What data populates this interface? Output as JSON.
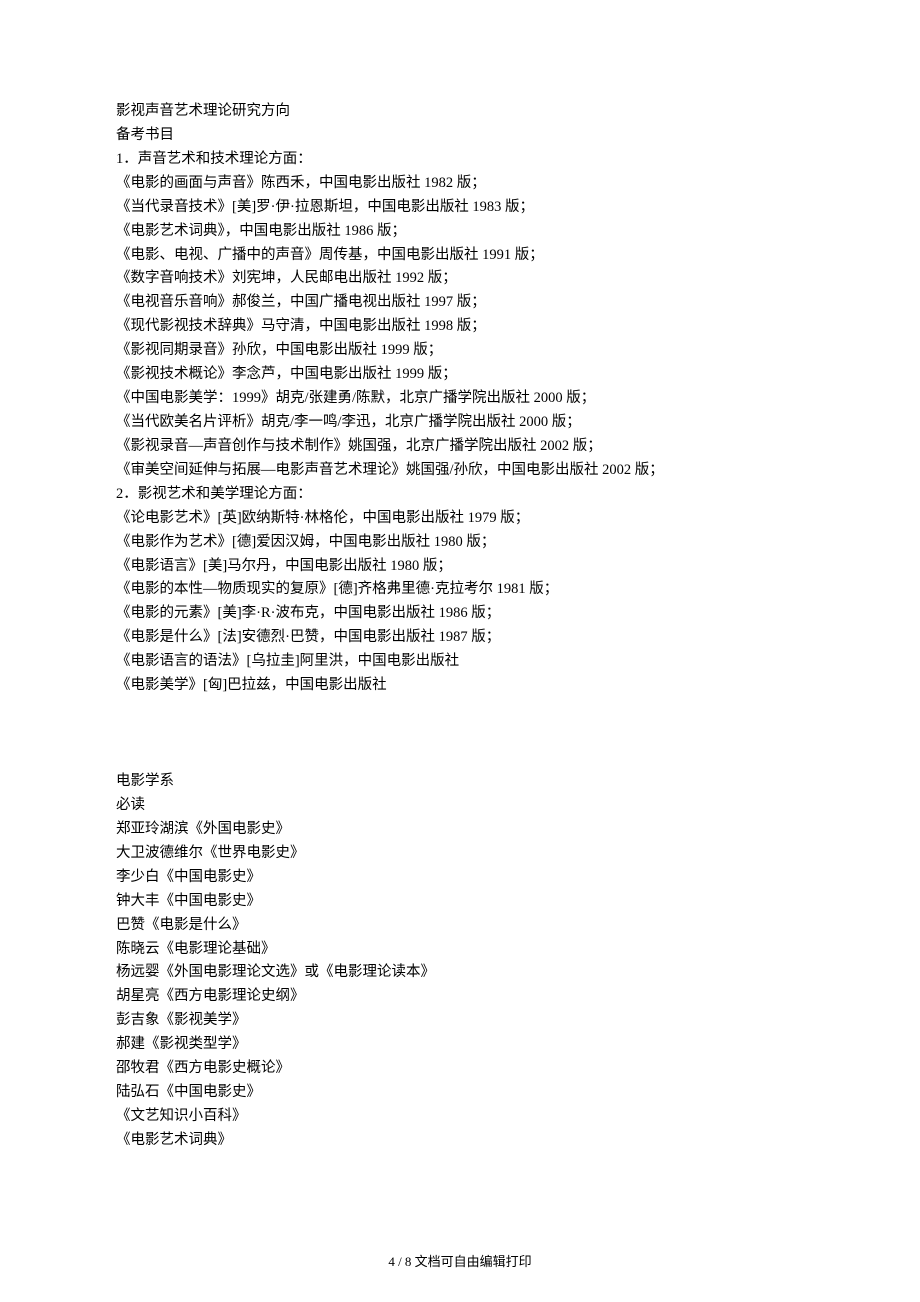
{
  "section1": {
    "title": "影视声音艺术理论研究方向",
    "subtitle": "备考书目",
    "cat1_header": "1．声音艺术和技术理论方面：",
    "cat1_items": [
      "《电影的画面与声音》陈西禾，中国电影出版社 1982 版；",
      "《当代录音技术》[美]罗·伊·拉恩斯坦，中国电影出版社 1983 版；",
      "《电影艺术词典》，中国电影出版社 1986 版；",
      "《电影、电视、广播中的声音》周传基，中国电影出版社 1991 版；",
      "《数字音响技术》刘宪坤，人民邮电出版社 1992 版；",
      "《电视音乐音响》郝俊兰，中国广播电视出版社 1997 版；",
      "《现代影视技术辞典》马守清，中国电影出版社 1998 版；",
      "《影视同期录音》孙欣，中国电影出版社 1999 版；",
      "《影视技术概论》李念芦，中国电影出版社 1999 版；",
      "《中国电影美学：1999》胡克/张建勇/陈默，北京广播学院出版社 2000 版；",
      "《当代欧美名片评析》胡克/李一鸣/李迅，北京广播学院出版社 2000 版；",
      "《影视录音—声音创作与技术制作》姚国强，北京广播学院出版社 2002 版；",
      "《审美空间延伸与拓展—电影声音艺术理论》姚国强/孙欣，中国电影出版社 2002 版；"
    ],
    "cat2_header": "2．影视艺术和美学理论方面：",
    "cat2_items": [
      "《论电影艺术》[英]欧纳斯特·林格伦，中国电影出版社 1979 版；",
      "《电影作为艺术》[德]爱因汉姆，中国电影出版社 1980 版；",
      "《电影语言》[美]马尔丹，中国电影出版社 1980 版；",
      "《电影的本性—物质现实的复原》[德]齐格弗里德·克拉考尔 1981 版；",
      "《电影的元素》[美]李·R·波布克，中国电影出版社 1986 版；",
      "《电影是什么》[法]安德烈·巴赞，中国电影出版社 1987 版；",
      "《电影语言的语法》[乌拉圭]阿里洪，中国电影出版社",
      "《电影美学》[匈]巴拉兹，中国电影出版社"
    ]
  },
  "section2": {
    "title": "电影学系",
    "subtitle": "必读",
    "items": [
      "郑亚玲湖滨《外国电影史》",
      "大卫波德维尔《世界电影史》",
      "李少白《中国电影史》",
      "钟大丰《中国电影史》",
      "巴赞《电影是什么》",
      "陈晓云《电影理论基础》",
      "杨远婴《外国电影理论文选》或《电影理论读本》",
      "胡星亮《西方电影理论史纲》",
      "彭吉象《影视美学》",
      "郝建《影视类型学》",
      "邵牧君《西方电影史概论》",
      "陆弘石《中国电影史》",
      "《文艺知识小百科》",
      "《电影艺术词典》"
    ]
  },
  "footer": {
    "text": "4 / 8 文档可自由编辑打印"
  }
}
